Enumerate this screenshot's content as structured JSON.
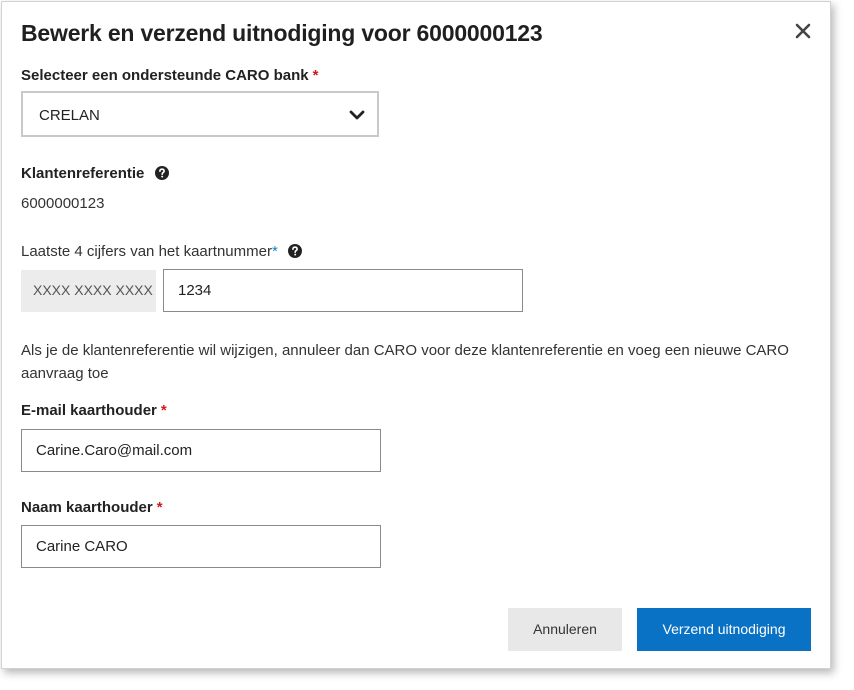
{
  "dialog": {
    "title": "Bewerk en verzend uitnodiging voor 6000000123",
    "close_icon": "close-icon"
  },
  "bank": {
    "label": "Selecteer een ondersteunde CARO bank",
    "required_mark": "*",
    "selected": "CRELAN"
  },
  "reference": {
    "label": "Klantenreferentie",
    "value": "6000000123"
  },
  "card": {
    "label": "Laatste 4 cijfers van het kaartnummer",
    "required_mark": "*",
    "prefix": "XXXX XXXX XXXX",
    "value": "1234"
  },
  "info_text": "Als je de klantenreferentie wil wijzigen, annuleer dan CARO voor deze klantenreferentie en voeg een nieuwe CARO aanvraag toe",
  "email": {
    "label": "E-mail kaarthouder",
    "required_mark": "*",
    "value": "Carine.Caro@mail.com"
  },
  "name": {
    "label": "Naam kaarthouder",
    "required_mark": "*",
    "value": "Carine CARO"
  },
  "buttons": {
    "cancel": "Annuleren",
    "submit": "Verzend uitnodiging"
  },
  "colors": {
    "primary": "#0a72c4",
    "required": "#d21a1a",
    "required_info": "#1a7fc9"
  }
}
